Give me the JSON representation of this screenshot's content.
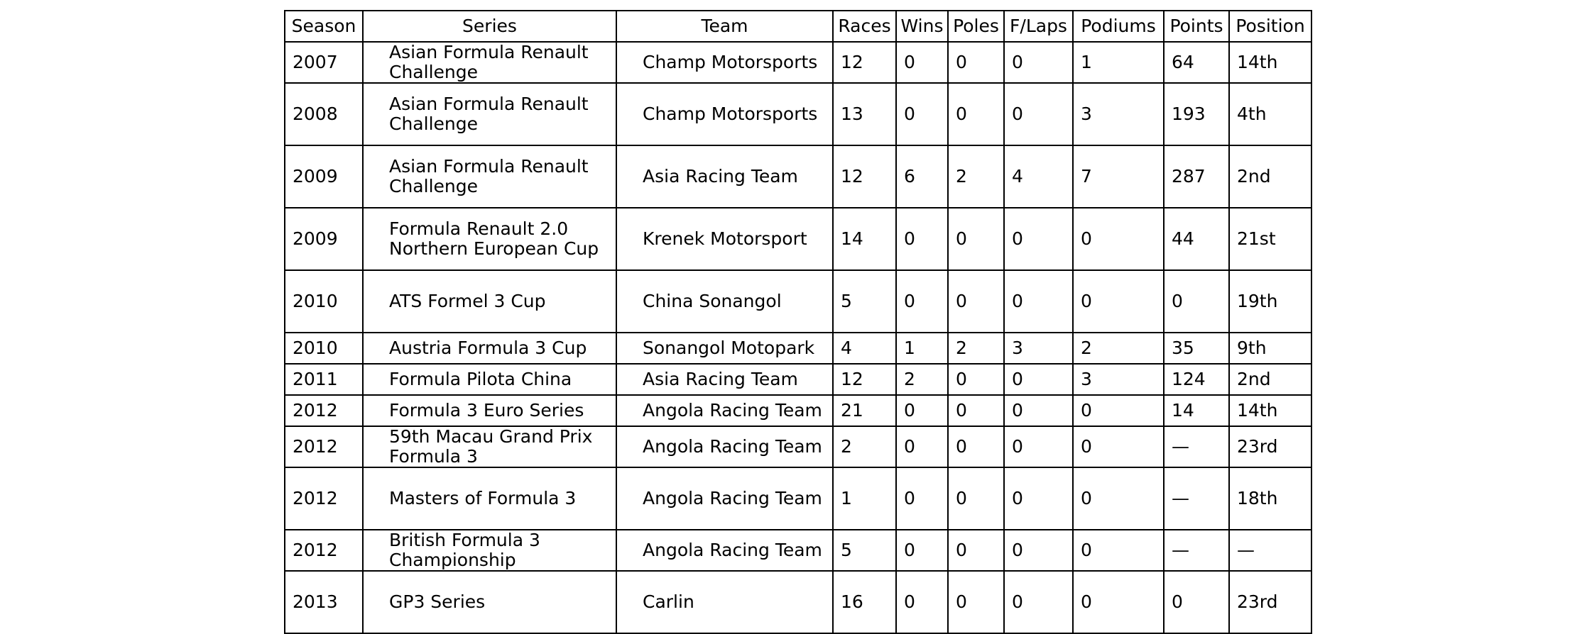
{
  "chart_data": {
    "type": "table",
    "columns": [
      "Season",
      "Series",
      "Team",
      "Races",
      "Wins",
      "Poles",
      "F/Laps",
      "Podiums",
      "Points",
      "Position"
    ],
    "rows": [
      [
        "2007",
        "Asian Formula Renault Challenge",
        "Champ Motorsports",
        "12",
        "0",
        "0",
        "0",
        "1",
        "64",
        "14th"
      ],
      [
        "2008",
        "Asian Formula Renault Challenge",
        "Champ Motorsports",
        "13",
        "0",
        "0",
        "0",
        "3",
        "193",
        "4th"
      ],
      [
        "2009",
        "Asian Formula Renault Challenge",
        "Asia Racing Team",
        "12",
        "6",
        "2",
        "4",
        "7",
        "287",
        "2nd"
      ],
      [
        "2009",
        "Formula Renault 2.0 Northern European Cup",
        "Krenek Motorsport",
        "14",
        "0",
        "0",
        "0",
        "0",
        "44",
        "21st"
      ],
      [
        "2010",
        "ATS Formel 3 Cup",
        "China Sonangol",
        "5",
        "0",
        "0",
        "0",
        "0",
        "0",
        "19th"
      ],
      [
        "2010",
        "Austria Formula 3 Cup",
        "Sonangol Motopark",
        "4",
        "1",
        "2",
        "3",
        "2",
        "35",
        "9th"
      ],
      [
        "2011",
        "Formula Pilota China",
        "Asia Racing Team",
        "12",
        "2",
        "0",
        "0",
        "3",
        "124",
        "2nd"
      ],
      [
        "2012",
        "Formula 3 Euro Series",
        "Angola Racing Team",
        "21",
        "0",
        "0",
        "0",
        "0",
        "14",
        "14th"
      ],
      [
        "2012",
        "59th Macau Grand Prix Formula 3",
        "Angola Racing Team",
        "2",
        "0",
        "0",
        "0",
        "0",
        "—",
        "23rd"
      ],
      [
        "2012",
        "Masters of Formula 3",
        "Angola Racing Team",
        "1",
        "0",
        "0",
        "0",
        "0",
        "—",
        "18th"
      ],
      [
        "2012",
        "British Formula 3 Championship",
        "Angola Racing Team",
        "5",
        "0",
        "0",
        "0",
        "0",
        "—",
        "—"
      ],
      [
        "2013",
        "GP3 Series",
        "Carlin",
        "16",
        "0",
        "0",
        "0",
        "0",
        "0",
        "23rd"
      ]
    ]
  }
}
